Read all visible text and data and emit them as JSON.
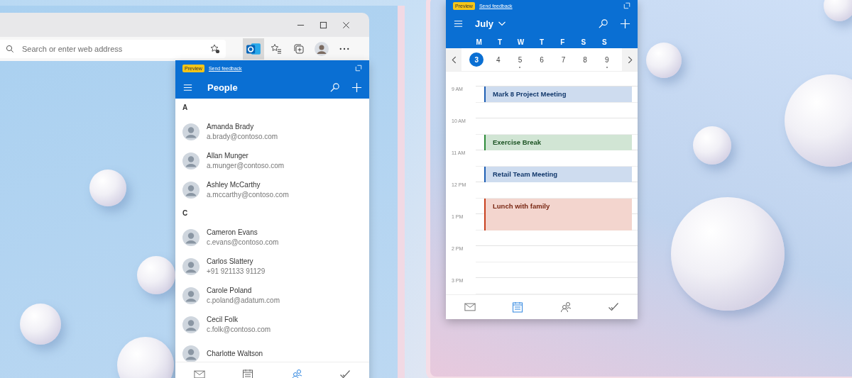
{
  "browser": {
    "address_placeholder": "Search or enter web address",
    "toolbar": [
      {
        "kind": "outlook",
        "selected": true
      },
      {
        "kind": "favorites",
        "selected": false
      },
      {
        "kind": "collections",
        "selected": false
      },
      {
        "kind": "profile",
        "selected": false
      },
      {
        "kind": "more",
        "selected": false
      }
    ]
  },
  "people_pane": {
    "badge": "Preview",
    "feedback_link": "Send feedback",
    "title": "People",
    "sections": [
      {
        "letter": "A",
        "contacts": [
          {
            "name": "Amanda Brady",
            "detail": "a.brady@contoso.com"
          },
          {
            "name": "Allan Munger",
            "detail": "a.munger@contoso.com"
          },
          {
            "name": "Ashley McCarthy",
            "detail": "a.mccarthy@contoso.com"
          }
        ]
      },
      {
        "letter": "C",
        "contacts": [
          {
            "name": "Cameron Evans",
            "detail": "c.evans@contoso.com"
          },
          {
            "name": "Carlos Slattery",
            "detail": "+91 921133 91129"
          },
          {
            "name": "Carole Poland",
            "detail": "c.poland@adatum.com"
          },
          {
            "name": "Cecil Folk",
            "detail": "c.folk@contoso.com"
          },
          {
            "name": "Charlotte Waltson"
          }
        ]
      }
    ],
    "nav": [
      {
        "kind": "mail",
        "selected": false
      },
      {
        "kind": "calendar",
        "selected": false
      },
      {
        "kind": "people",
        "selected": true
      },
      {
        "kind": "tasks",
        "selected": false
      }
    ]
  },
  "calendar_pane": {
    "badge": "Preview",
    "feedback_link": "Send feedback",
    "month": "July",
    "weekdays": [
      "M",
      "T",
      "W",
      "T",
      "F",
      "S",
      "S"
    ],
    "days": [
      {
        "label": "3",
        "selected": true,
        "has_events": false
      },
      {
        "label": "4",
        "selected": false,
        "has_events": false
      },
      {
        "label": "5",
        "selected": false,
        "has_events": true
      },
      {
        "label": "6",
        "selected": false,
        "has_events": false
      },
      {
        "label": "7",
        "selected": false,
        "has_events": false
      },
      {
        "label": "8",
        "selected": false,
        "has_events": false
      },
      {
        "label": "9",
        "selected": false,
        "has_events": true
      }
    ],
    "hours": [
      {
        "label": "9 AM",
        "event": {
          "title": "Mark 8 Project Meeting",
          "color": "#1f5fb4",
          "kind": "early"
        }
      },
      {
        "label": "10 AM",
        "event": {
          "title": "Exercise Break",
          "color": "#2e8b3a",
          "kind": "late"
        }
      },
      {
        "label": "11 AM",
        "event": {
          "title": "Retail Team Meeting",
          "color": "#1f5fb4",
          "kind": "late"
        }
      },
      {
        "label": "12 PM",
        "event": {
          "title": "Lunch with family",
          "color": "#c8401e",
          "kind": "long"
        }
      },
      {
        "label": "1 PM"
      },
      {
        "label": "2 PM"
      },
      {
        "label": "3 PM"
      }
    ],
    "nav": [
      {
        "kind": "mail",
        "selected": false
      },
      {
        "kind": "calendar",
        "selected": true
      },
      {
        "kind": "people",
        "selected": false
      },
      {
        "kind": "tasks",
        "selected": false
      }
    ]
  }
}
